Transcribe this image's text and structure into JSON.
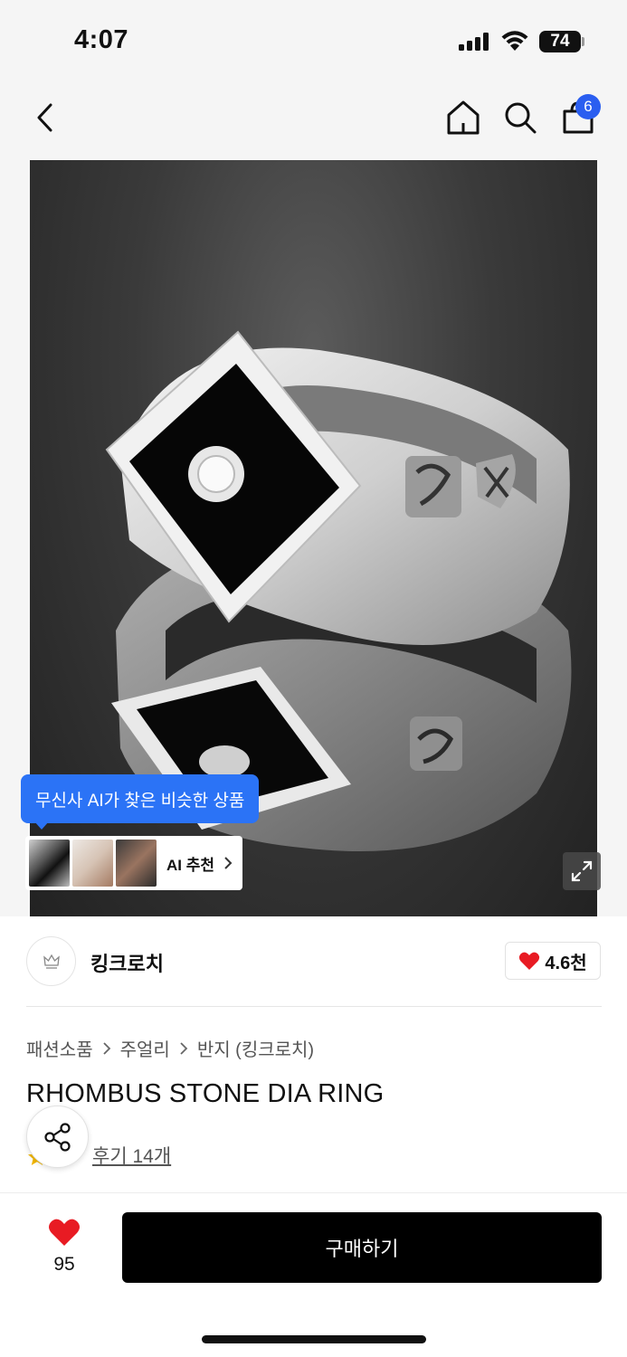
{
  "status_bar": {
    "time": "4:07",
    "battery": "74"
  },
  "nav": {
    "cart_count": "6"
  },
  "ai": {
    "bubble_text": "무신사 AI가 찾은 비슷한 상품",
    "card_label": "AI 추천"
  },
  "brand": {
    "name": "킹크로치",
    "likes": "4.6천"
  },
  "breadcrumb": [
    "패션소품",
    "주얼리",
    "반지 (킹크로치)"
  ],
  "product": {
    "title": "RHOMBUS STONE DIA RING",
    "review_link": "후기 14개"
  },
  "bottom_bar": {
    "like_count": "95",
    "buy_label": "구매하기"
  },
  "colors": {
    "accent_blue": "#2b73f6",
    "heart_red": "#e81b23",
    "badge_blue": "#2a5ef0"
  }
}
